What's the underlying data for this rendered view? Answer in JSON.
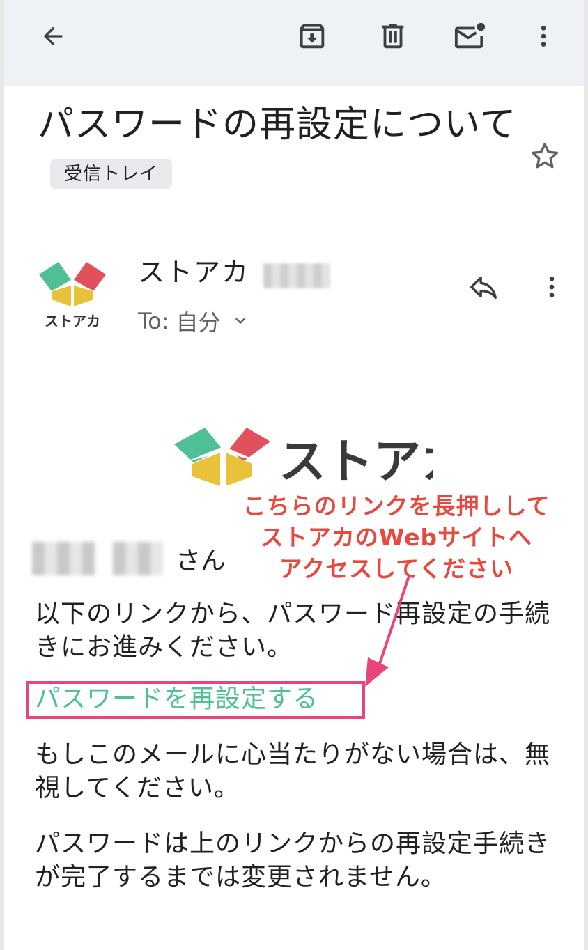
{
  "toolbar": {
    "back": "back-arrow-icon",
    "archive": "archive-icon",
    "delete": "trash-icon",
    "mark_unread": "mail-unread-icon",
    "more": "more-vert-icon"
  },
  "email": {
    "subject": "パスワードの再設定について",
    "label_chip": "受信トレイ",
    "sender_name": "ストアカ",
    "recipient_label": "To:",
    "recipient_value": "自分",
    "greeting_suffix": "さん",
    "paragraph_1": "以下のリンクから、パスワード再設定の手続きにお進みください。",
    "reset_link": "パスワードを再設定する",
    "paragraph_2": "もしこのメールに心当たりがない場合は、無視してください。",
    "paragraph_3": "パスワードは上のリンクからの再設定手続きが完了するまでは変更されません。"
  },
  "brand": {
    "logo_text": "ストアカ",
    "avatar_text": "ストアカ"
  },
  "annotation": {
    "line_1": "こちらのリンクを長押しして",
    "line_2": "ストアカのWebサイトへ",
    "line_3": "アクセスしてください"
  },
  "colors": {
    "toolbar_bg": "#eef1f6",
    "link": "#4fbf96",
    "highlight_border": "#e8457a",
    "annotation": "#e8483e",
    "logo_green": "#4fbf96",
    "logo_red": "#e0515b",
    "logo_yellow": "#e8c23a"
  }
}
